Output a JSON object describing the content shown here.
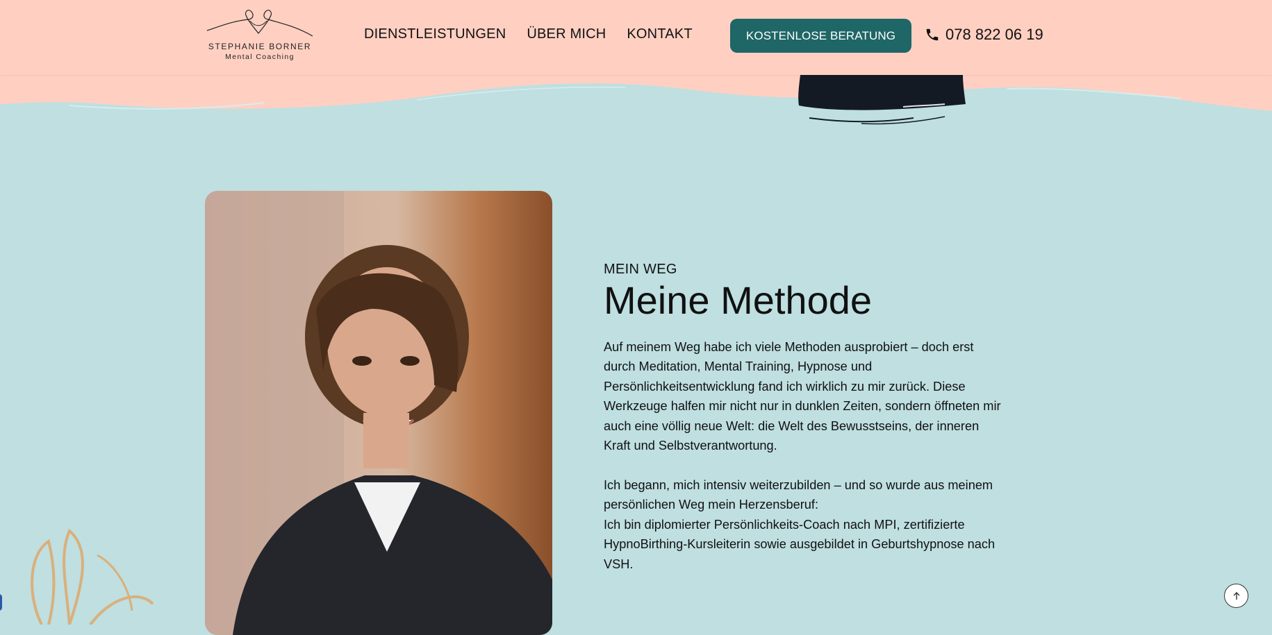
{
  "header": {
    "logo": {
      "name": "STEPHANIE BORNER",
      "tagline": "Mental Coaching"
    },
    "nav": [
      {
        "label": "DIENSTLEISTUNGEN"
      },
      {
        "label": "ÜBER MICH"
      },
      {
        "label": "KONTAKT"
      }
    ],
    "cta_label": "KOSTENLOSE BERATUNG",
    "phone": {
      "icon": "phone-icon",
      "number": "078 822 06 19"
    }
  },
  "section": {
    "eyebrow": "MEIN WEG",
    "title": "Meine Methode",
    "paragraph1": "Auf meinem Weg habe ich viele Methoden ausprobiert – doch erst durch Meditation, Mental Training, Hypnose und Persönlichkeitsentwicklung fand ich wirklich zu mir zurück. Diese Werkzeuge halfen mir nicht nur in dunklen Zeiten, sondern öffneten mir auch eine völlig neue Welt: die Welt des Bewusstseins, der inneren Kraft und Selbstverantwortung.",
    "paragraph2_line1": "Ich begann, mich intensiv weiterzubilden – und so wurde aus meinem persönlichen Weg mein Herzensberuf:",
    "paragraph2_line2": "Ich bin diplomierter Persönlichkeits-Coach nach MPI, zertifizierte HypnoBirthing-Kursleiterin sowie ausgebildet in Geburtshypnose nach VSH."
  },
  "scroll_top": {
    "icon": "arrow-up-icon"
  },
  "colors": {
    "header_bg": "#ffd0c2",
    "section_bg": "#bfdfe1",
    "cta_bg": "#1f6667",
    "plant": "#d9b07c"
  }
}
